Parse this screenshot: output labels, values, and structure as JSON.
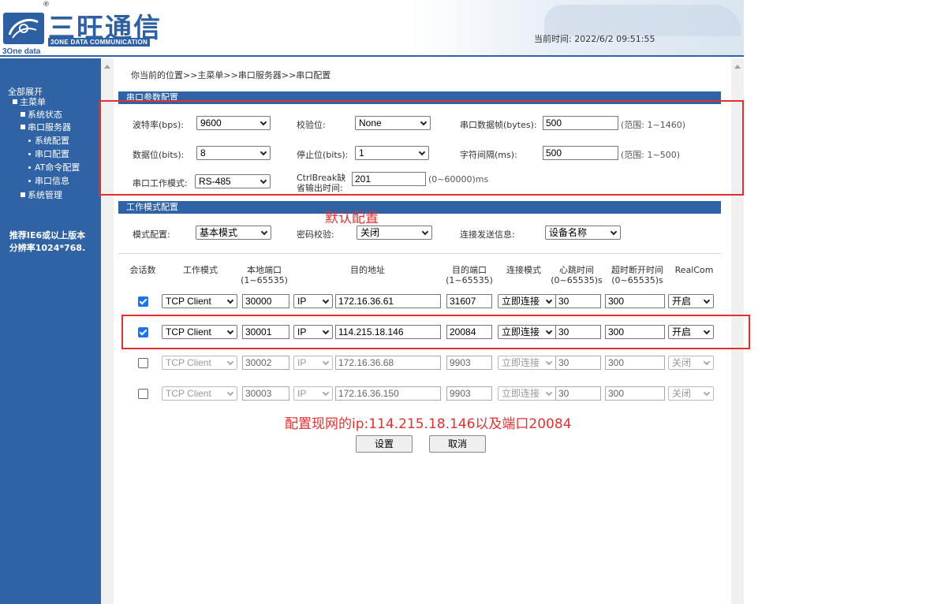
{
  "header": {
    "logo_cn": "三旺通信",
    "logo_en": "3ONE DATA COMMUNICATION",
    "logo_sub": "3One data",
    "logo_reg": "®",
    "time_label": "当前时间: ",
    "time_value": "2022/6/2 09:51:55"
  },
  "sidebar": {
    "expand_all": "全部展开",
    "main_menu": "主菜单",
    "items": [
      {
        "label": "系统状态"
      },
      {
        "label": "串口服务器"
      },
      {
        "label": "系统配置"
      },
      {
        "label": "串口配置"
      },
      {
        "label": "AT命令配置"
      },
      {
        "label": "串口信息"
      },
      {
        "label": "系统管理"
      }
    ],
    "note_line1": "推荐IE6或以上版本",
    "note_line2": "分辨率1024*768."
  },
  "breadcrumb": "你当前的位置>>主菜单>>串口服务器>>串口配置",
  "serial": {
    "title": "串口参数配置",
    "baud_label": "波特率(bps):",
    "baud_value": "9600",
    "parity_label": "校验位:",
    "parity_value": "None",
    "frame_label": "串口数据帧(bytes):",
    "frame_value": "500",
    "frame_hint": "(范围: 1~1460)",
    "databits_label": "数据位(bits):",
    "databits_value": "8",
    "stopbits_label": "停止位(bits):",
    "stopbits_value": "1",
    "interval_label": "字符间隔(ms):",
    "interval_value": "500",
    "interval_hint": "(范围: 1~500)",
    "mode_label": "串口工作模式:",
    "mode_value": "RS-485",
    "ctrlbreak_label1": "CtrlBreak缺",
    "ctrlbreak_label2": "省输出时间:",
    "ctrlbreak_value": "201",
    "ctrlbreak_hint": "(0~60000)ms"
  },
  "work": {
    "title": "工作模式配置",
    "mode_label": "模式配置:",
    "mode_value": "基本模式",
    "pwd_label": "密码校验:",
    "pwd_value": "关闭",
    "send_label": "连接发送信息:",
    "send_value": "设备名称"
  },
  "table": {
    "headers": {
      "sessions": "会话数",
      "work_mode": "工作模式",
      "local_port": "本地端口",
      "local_port_range": "(1~65535)",
      "dest_addr": "目的地址",
      "dest_port": "目的端口",
      "dest_port_range": "(1~65535)",
      "conn_mode": "连接模式",
      "heartbeat": "心跳时间",
      "heartbeat_range": "(0~65535)s",
      "timeout": "超时断开时间",
      "timeout_range": "(0~65535)s",
      "realcom": "RealCom"
    },
    "rows": [
      {
        "mode": "TCP Client",
        "local_port": "30000",
        "addr_type": "IP",
        "addr": "172.16.36.61",
        "dest_port": "31607",
        "conn": "立即连接",
        "heartbeat": "30",
        "timeout": "300",
        "realcom": "开启"
      },
      {
        "mode": "TCP Client",
        "local_port": "30001",
        "addr_type": "IP",
        "addr": "114.215.18.146",
        "dest_port": "20084",
        "conn": "立即连接",
        "heartbeat": "30",
        "timeout": "300",
        "realcom": "开启"
      },
      {
        "mode": "TCP Client",
        "local_port": "30002",
        "addr_type": "IP",
        "addr": "172.16.36.68",
        "dest_port": "9903",
        "conn": "立即连接",
        "heartbeat": "30",
        "timeout": "300",
        "realcom": "关闭"
      },
      {
        "mode": "TCP Client",
        "local_port": "30003",
        "addr_type": "IP",
        "addr": "172.16.36.150",
        "dest_port": "9903",
        "conn": "立即连接",
        "heartbeat": "30",
        "timeout": "300",
        "realcom": "关闭"
      }
    ]
  },
  "buttons": {
    "set": "设置",
    "cancel": "取消"
  },
  "annotations": {
    "default_config": "默认配置",
    "note": "配置现网的ip:114.215.18.146以及端口20084"
  },
  "colors": {
    "brand_blue": "#2f63a5",
    "annotation_red": "#e03030",
    "checkbox_blue": "#1a73e8"
  }
}
